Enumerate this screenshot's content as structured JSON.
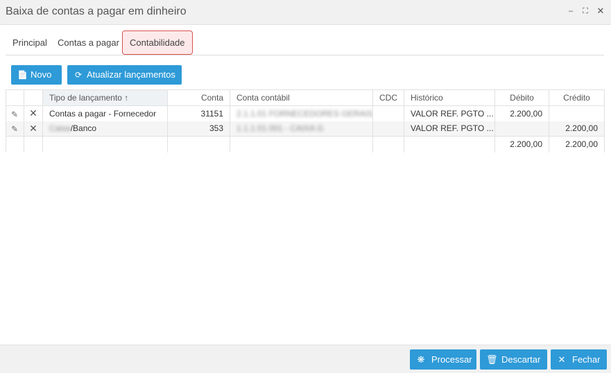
{
  "window": {
    "title": "Baixa de contas a pagar em dinheiro",
    "controls": {
      "minimize": "‒",
      "maximize": "⛶",
      "close": "✕"
    }
  },
  "tabs": [
    {
      "label": "Principal"
    },
    {
      "label": "Contas a pagar"
    },
    {
      "label": "Contabilidade",
      "active": true
    }
  ],
  "toolbar": {
    "novo_label": "Novo",
    "atualizar_label": "Atualizar lançamentos"
  },
  "grid": {
    "columns": {
      "tipo": "Tipo de lançamento ↑",
      "conta": "Conta",
      "conta_contabil": "Conta contábil",
      "cdc": "CDC",
      "historico": "Histórico",
      "debito": "Débito",
      "credito": "Crédito"
    },
    "rows": [
      {
        "tipo": "Contas a pagar - Fornecedor",
        "tipo_prefix": "",
        "conta": "31151",
        "conta_contabil": "2.1.1.01 FORNECEDORES GERAIS...",
        "cdc": "",
        "historico": "VALOR REF. PGTO ...",
        "debito": "2.200,00",
        "credito": ""
      },
      {
        "tipo": "/Banco",
        "tipo_prefix": "Caixa",
        "conta": "353",
        "conta_contabil": "1.1.1.01.001 - CAIXA G",
        "cdc": "",
        "historico": "VALOR REF. PGTO ...",
        "debito": "",
        "credito": "2.200,00"
      }
    ],
    "totals": {
      "debito": "2.200,00",
      "credito": "2.200,00"
    }
  },
  "footer": {
    "processar_label": "Processar",
    "descartar_label": "Descartar",
    "fechar_label": "Fechar"
  },
  "colors": {
    "primary": "#2e9ad8",
    "active_tab_border": "#d9534f"
  }
}
